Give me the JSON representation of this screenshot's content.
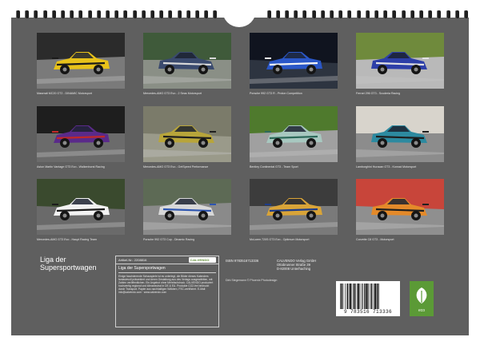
{
  "photos": [
    {
      "caption": "Maserati MC20 GT2 - DINAMIC Motorsport",
      "bg": "#2b2b2b",
      "ground": "#7a7a7a",
      "car": "#e8c21a",
      "accent": "#1b1b1b"
    },
    {
      "caption": "Mercedes-AMG GT3 Evo - 2 Seas Motorsport",
      "bg": "#3f5a3a",
      "ground": "#8a8f86",
      "car": "#3a4a6e",
      "accent": "#d8d8d8"
    },
    {
      "caption": "Porsche 992 GT3 R - Proton Competition",
      "bg": "#10141f",
      "ground": "#2d3440",
      "car": "#2a57c8",
      "accent": "#f4f4f4"
    },
    {
      "caption": "Ferrari 296 GT3 - Scuderia Racing",
      "bg": "#6f8a3c",
      "ground": "#b9b9b9",
      "car": "#2d3fa8",
      "accent": "#e3e3e3"
    },
    {
      "caption": "Aston Martin Vantage GT3 Evo - Walkenhorst Racing",
      "bg": "#1e1e1e",
      "ground": "#6b6b6b",
      "car": "#5a2a8a",
      "accent": "#c02828"
    },
    {
      "caption": "Mercedes-AMG GT3 Evo - GetSpeed Performance",
      "bg": "#7b7b6a",
      "ground": "#9a9a8a",
      "car": "#b8a53a",
      "accent": "#1f1f1f"
    },
    {
      "caption": "Bentley Continental GT3 - Team Sport",
      "bg": "#4f7a2d",
      "ground": "#a0a0a0",
      "car": "#a8c8c0",
      "accent": "#2d6a5a"
    },
    {
      "caption": "Lamborghini Huracan GT3 - Konrad Motorsport",
      "bg": "#d8d4cc",
      "ground": "#8c8c8c",
      "car": "#2d8aa0",
      "accent": "#1f1f1f"
    },
    {
      "caption": "Mercedes-AMG GT3 Evo - Haupt Racing Team",
      "bg": "#3a4a2e",
      "ground": "#6a6a6a",
      "car": "#f2f2f2",
      "accent": "#1b1b1b"
    },
    {
      "caption": "Porsche 992 GT3 Cup - Dinamic Racing",
      "bg": "#5d6a55",
      "ground": "#8a8a8a",
      "car": "#d8d8d8",
      "accent": "#2d55b0"
    },
    {
      "caption": "McLaren 720S GT3 Evo - Optimum Motorsport",
      "bg": "#3c3c3c",
      "ground": "#7a7a7a",
      "car": "#d9a438",
      "accent": "#1d3c8a"
    },
    {
      "caption": "Corvette C8 GT3 - Motorsport",
      "bg": "#c8453a",
      "ground": "#8f8f8f",
      "car": "#e48a2a",
      "accent": "#1f1f1f"
    }
  ],
  "calendar_title": [
    "Liga der",
    "Supersportwagen"
  ],
  "info": {
    "article": "Artikel-Nr.: 2208816",
    "logo": "CALVENDO",
    "heading": "Liga der Supersportwagen",
    "body": "Einige faszinierende Schauspiele ist es unterlegt, die Bilder dieses Kalenders fantasievoll präsentiert und deren Gestaltung aus des Verlags ausgewählten, mit Zahlen veröffentlichen. Ein Angebot ohne Mehrfachdruck. CALVENDO produziert hochwertig regional und klimaneutral in DE & EU. Produkte CO2-frei bedruckt durch Transport. Papier aus nachhaltigen Wäldern, FSC-zertifiziert. E-Mail: info@calvendo.com · www.calvendo.com"
  },
  "isbn": "ISBN 9783516713336",
  "publisher": [
    "CALVENDO Verlag GmbH",
    "Ottobrunner Straße 39",
    "D-82008 Unterhaching"
  ],
  "author": "Dirk Stegemann © Phoenix Photodesign",
  "barcode_number": "9 783516 713336",
  "eco_label": "eco",
  "colors": {
    "board": "#5f5f5f",
    "eco_green": "#5b9a36",
    "logo_green": "#5a8b2d"
  }
}
